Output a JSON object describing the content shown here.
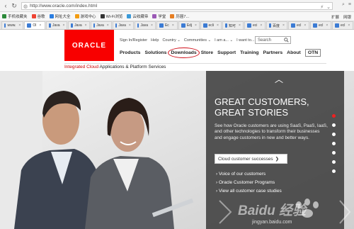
{
  "browser": {
    "url": "http://www.oracle.com/index.html",
    "bookmarks": [
      "手机收藏夹",
      "谷歌",
      "网址大全",
      "游戏中心",
      "Wi-Fi浏览",
      "云收藏帝",
      "学堂",
      "历届7..."
    ],
    "bookmarks_right": [
      "扩展",
      "网银"
    ],
    "tabs": [
      {
        "label": "www.",
        "active": false
      },
      {
        "label": "Ol",
        "active": true
      },
      {
        "label": "Java",
        "active": false
      },
      {
        "label": "Java",
        "active": false
      },
      {
        "label": "Java",
        "active": false
      },
      {
        "label": "Java",
        "active": false
      },
      {
        "label": "Java",
        "active": false
      },
      {
        "label": "Ec",
        "active": false
      },
      {
        "label": "Edj",
        "active": false
      },
      {
        "label": "ecli",
        "active": false
      },
      {
        "label": "知可",
        "active": false
      },
      {
        "label": "eci",
        "active": false
      },
      {
        "label": "百度",
        "active": false
      },
      {
        "label": "ecl",
        "active": false
      },
      {
        "label": "ecl",
        "active": false
      },
      {
        "label": "ecl",
        "active": false
      }
    ]
  },
  "oracle": {
    "logo": "ORACLE",
    "util_links": [
      "Sign In/Register",
      "Help",
      "Country ⌄",
      "Communities ⌄",
      "I am a... ⌄",
      "I want to... ⌄"
    ],
    "search_placeholder": "Search",
    "nav": [
      "Products",
      "Solutions",
      "Downloads",
      "Store",
      "Support",
      "Training",
      "Partners",
      "About"
    ],
    "otn": "OTN",
    "subtitle_red": "Integrated Cloud",
    "subtitle_rest": " Applications & Platform Services"
  },
  "hero": {
    "title_line1": "GREAT CUSTOMERS,",
    "title_line2": "GREAT STORIES",
    "body": "See how Oracle customers are using SaaS, PaaS, IaaS, and other technologies to transform their businesses and engage customers in new and better ways.",
    "cta": "Cloud customer successes",
    "links": [
      "Voice of our customers",
      "Oracle Customer Programs",
      "View all customer case studies"
    ],
    "slide_count": 7,
    "active_slide": 1
  },
  "watermark": {
    "text": "Baidu 经验",
    "url": "jingyan.baidu.com"
  }
}
